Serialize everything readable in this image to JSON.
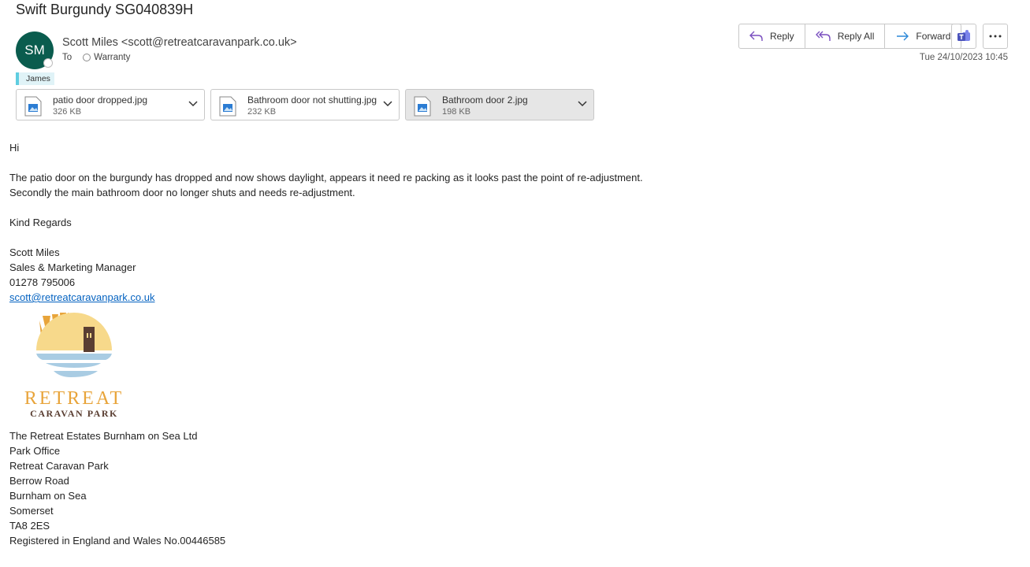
{
  "subject": "Swift Burgundy SG040839H",
  "sender": {
    "initials": "SM",
    "display": "Scott Miles <scott@retreatcaravanpark.co.uk>",
    "to_label": "To",
    "to_value": "Warranty",
    "category": "James"
  },
  "toolbar": {
    "reply": "Reply",
    "reply_all": "Reply All",
    "forward": "Forward"
  },
  "date": "Tue 24/10/2023 10:45",
  "attachments": [
    {
      "name": "patio door dropped.jpg",
      "size": "326 KB"
    },
    {
      "name": "Bathroom door not shutting.jpg",
      "size": "232 KB"
    },
    {
      "name": "Bathroom door 2.jpg",
      "size": "198 KB"
    }
  ],
  "body": {
    "greeting": "Hi",
    "line1": "The patio door on the burgundy has dropped and now shows daylight, appears it need re packing as it looks past the point of re-adjustment.",
    "line2": "Secondly the main bathroom door no longer shuts and needs re-adjustment.",
    "signoff": "Kind Regards",
    "name": "Scott Miles",
    "title": "Sales & Marketing Manager",
    "phone": "01278 795006",
    "email": "scott@retreatcaravanpark.co.uk",
    "logo_text": "RETREAT",
    "logo_subtext": "CARAVAN PARK",
    "address": [
      "The Retreat Estates Burnham on Sea Ltd",
      "Park Office",
      "Retreat Caravan Park",
      "Berrow Road",
      "Burnham on Sea",
      "Somerset",
      "TA8 2ES",
      "Registered in England and Wales No.00446585"
    ]
  },
  "colors": {
    "avatar": "#0a5c4e",
    "category": "#5fcde0",
    "link": "#0563c1",
    "logo_orange": "#e8a43a",
    "logo_blue": "#a9cce3"
  }
}
